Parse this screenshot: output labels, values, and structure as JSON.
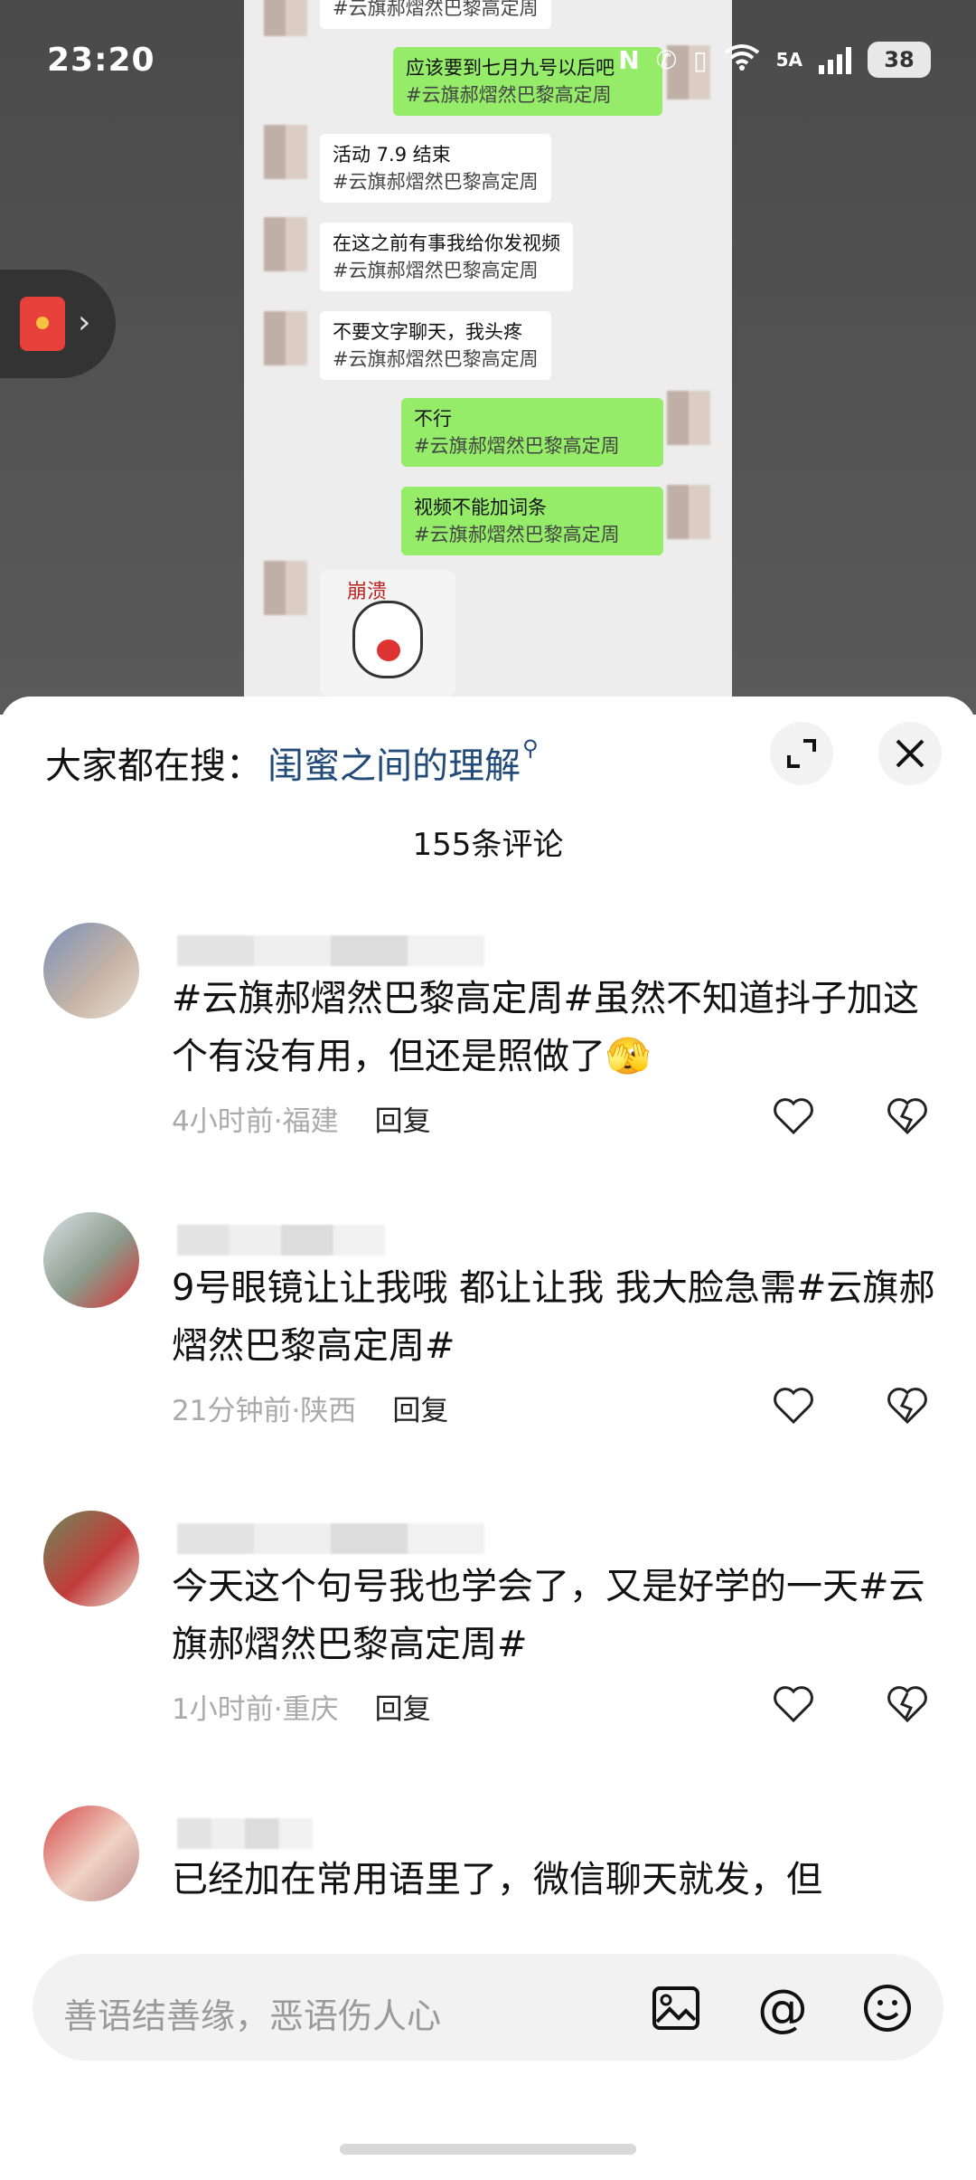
{
  "status_bar": {
    "time": "23:20",
    "network": "5A",
    "battery": "38"
  },
  "chat_messages": [
    {
      "side": "left",
      "text": "",
      "tag": "#云旗郝熠然巴黎高定周"
    },
    {
      "side": "right",
      "text": "应该要到七月九号以后吧",
      "tag": "#云旗郝熠然巴黎高定周"
    },
    {
      "side": "left",
      "text": "活动 7.9 结束",
      "tag": "#云旗郝熠然巴黎高定周"
    },
    {
      "side": "left",
      "text": "在这之前有事我给你发视频",
      "tag": "#云旗郝熠然巴黎高定周"
    },
    {
      "side": "left",
      "text": "不要文字聊天，我头疼",
      "tag": "#云旗郝熠然巴黎高定周"
    },
    {
      "side": "right",
      "text": "不行",
      "tag": "#云旗郝熠然巴黎高定周"
    },
    {
      "side": "right",
      "text": "视频不能加词条",
      "tag": "#云旗郝熠然巴黎高定周"
    }
  ],
  "sticker_text": "崩溃",
  "search": {
    "label": "大家都在搜：",
    "term": "闺蜜之间的理解"
  },
  "comment_count": "155条评论",
  "comments": [
    {
      "text": "#云旗郝熠然巴黎高定周#虽然不知道抖子加这个有没有用，但还是照做了🫣",
      "time_loc": "4小时前·福建",
      "reply": "回复"
    },
    {
      "text": "9号眼镜让让我哦 都让让我 我大脸急需#云旗郝熠然巴黎高定周#",
      "time_loc": "21分钟前·陕西",
      "reply": "回复"
    },
    {
      "text": "今天这个句号我也学会了，又是好学的一天#云旗郝熠然巴黎高定周#",
      "time_loc": "1小时前·重庆",
      "reply": "回复"
    },
    {
      "text": "已经加在常用语里了，微信聊天就发，但",
      "time_loc": "",
      "reply": ""
    }
  ],
  "input": {
    "placeholder": "善语结善缘，恶语伤人心"
  },
  "colors": {
    "accent_blue": "#234b7a",
    "bubble_green": "#95ec69"
  }
}
